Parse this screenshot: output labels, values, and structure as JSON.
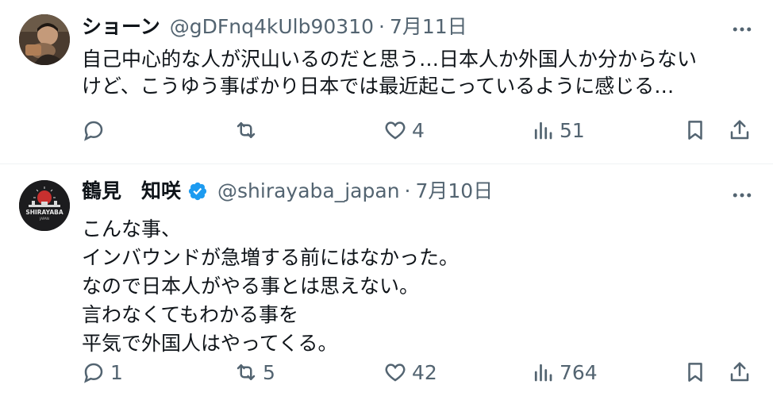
{
  "tweets": [
    {
      "name": "ショーン",
      "handle": "@gDFnq4kUlb90310",
      "separator": "·",
      "date": "7月11日",
      "text": "自己中心的な人が沢山いるのだと思う…日本人か外国人か分からない\nけど、こうゆう事ばかり日本では最近起こっているように感じる…",
      "actions": {
        "reply": "",
        "retweet": "",
        "like": "4",
        "views": "51"
      },
      "verified": false,
      "avatar_icon": "profile-photo"
    },
    {
      "name": "鶴見　知咲",
      "handle": "@shirayaba_japan",
      "separator": "·",
      "date": "7月10日",
      "text": "こんな事、\nインバウンドが急増する前にはなかった。\nなので日本人がやる事とは思えない。\n言わなくてもわかる事を\n平気で外国人はやってくる。",
      "actions": {
        "reply": "1",
        "retweet": "5",
        "like": "42",
        "views": "764"
      },
      "verified": true,
      "avatar_icon": "shirayaba-logo",
      "avatar_text": "SHIRAYABA",
      "avatar_subtext": "JAPAN"
    }
  ],
  "colors": {
    "text": "#0f1419",
    "muted": "#536471",
    "verified": "#1d9bf0",
    "divider": "#eff3f4"
  }
}
